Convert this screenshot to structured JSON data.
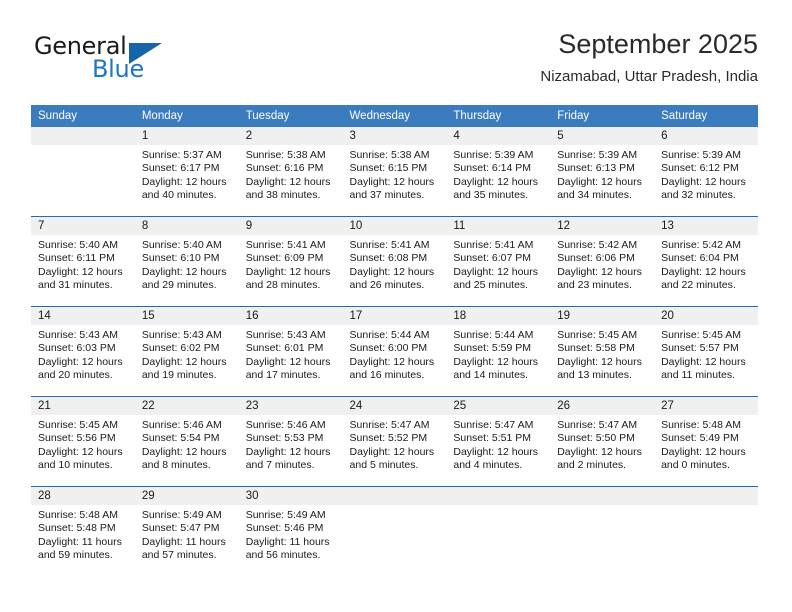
{
  "brand": {
    "name_top": "General",
    "name_bottom": "Blue",
    "color_primary": "#1f77c4",
    "color_triangle": "#1565a8"
  },
  "header": {
    "title": "September 2025",
    "subtitle": "Nizamabad, Uttar Pradesh, India"
  },
  "calendar": {
    "header_bg": "#3a7cbe",
    "daynum_bg": "#f0f0f0",
    "grid_line": "#1f6eb4",
    "weekdays": [
      "Sunday",
      "Monday",
      "Tuesday",
      "Wednesday",
      "Thursday",
      "Friday",
      "Saturday"
    ],
    "weeks": [
      [
        {
          "day": "",
          "sunrise": "",
          "sunset": "",
          "daylight1": "",
          "daylight2": "",
          "empty": true
        },
        {
          "day": "1",
          "sunrise": "Sunrise: 5:37 AM",
          "sunset": "Sunset: 6:17 PM",
          "daylight1": "Daylight: 12 hours",
          "daylight2": "and 40 minutes."
        },
        {
          "day": "2",
          "sunrise": "Sunrise: 5:38 AM",
          "sunset": "Sunset: 6:16 PM",
          "daylight1": "Daylight: 12 hours",
          "daylight2": "and 38 minutes."
        },
        {
          "day": "3",
          "sunrise": "Sunrise: 5:38 AM",
          "sunset": "Sunset: 6:15 PM",
          "daylight1": "Daylight: 12 hours",
          "daylight2": "and 37 minutes."
        },
        {
          "day": "4",
          "sunrise": "Sunrise: 5:39 AM",
          "sunset": "Sunset: 6:14 PM",
          "daylight1": "Daylight: 12 hours",
          "daylight2": "and 35 minutes."
        },
        {
          "day": "5",
          "sunrise": "Sunrise: 5:39 AM",
          "sunset": "Sunset: 6:13 PM",
          "daylight1": "Daylight: 12 hours",
          "daylight2": "and 34 minutes."
        },
        {
          "day": "6",
          "sunrise": "Sunrise: 5:39 AM",
          "sunset": "Sunset: 6:12 PM",
          "daylight1": "Daylight: 12 hours",
          "daylight2": "and 32 minutes."
        }
      ],
      [
        {
          "day": "7",
          "sunrise": "Sunrise: 5:40 AM",
          "sunset": "Sunset: 6:11 PM",
          "daylight1": "Daylight: 12 hours",
          "daylight2": "and 31 minutes."
        },
        {
          "day": "8",
          "sunrise": "Sunrise: 5:40 AM",
          "sunset": "Sunset: 6:10 PM",
          "daylight1": "Daylight: 12 hours",
          "daylight2": "and 29 minutes."
        },
        {
          "day": "9",
          "sunrise": "Sunrise: 5:41 AM",
          "sunset": "Sunset: 6:09 PM",
          "daylight1": "Daylight: 12 hours",
          "daylight2": "and 28 minutes."
        },
        {
          "day": "10",
          "sunrise": "Sunrise: 5:41 AM",
          "sunset": "Sunset: 6:08 PM",
          "daylight1": "Daylight: 12 hours",
          "daylight2": "and 26 minutes."
        },
        {
          "day": "11",
          "sunrise": "Sunrise: 5:41 AM",
          "sunset": "Sunset: 6:07 PM",
          "daylight1": "Daylight: 12 hours",
          "daylight2": "and 25 minutes."
        },
        {
          "day": "12",
          "sunrise": "Sunrise: 5:42 AM",
          "sunset": "Sunset: 6:06 PM",
          "daylight1": "Daylight: 12 hours",
          "daylight2": "and 23 minutes."
        },
        {
          "day": "13",
          "sunrise": "Sunrise: 5:42 AM",
          "sunset": "Sunset: 6:04 PM",
          "daylight1": "Daylight: 12 hours",
          "daylight2": "and 22 minutes."
        }
      ],
      [
        {
          "day": "14",
          "sunrise": "Sunrise: 5:43 AM",
          "sunset": "Sunset: 6:03 PM",
          "daylight1": "Daylight: 12 hours",
          "daylight2": "and 20 minutes."
        },
        {
          "day": "15",
          "sunrise": "Sunrise: 5:43 AM",
          "sunset": "Sunset: 6:02 PM",
          "daylight1": "Daylight: 12 hours",
          "daylight2": "and 19 minutes."
        },
        {
          "day": "16",
          "sunrise": "Sunrise: 5:43 AM",
          "sunset": "Sunset: 6:01 PM",
          "daylight1": "Daylight: 12 hours",
          "daylight2": "and 17 minutes."
        },
        {
          "day": "17",
          "sunrise": "Sunrise: 5:44 AM",
          "sunset": "Sunset: 6:00 PM",
          "daylight1": "Daylight: 12 hours",
          "daylight2": "and 16 minutes."
        },
        {
          "day": "18",
          "sunrise": "Sunrise: 5:44 AM",
          "sunset": "Sunset: 5:59 PM",
          "daylight1": "Daylight: 12 hours",
          "daylight2": "and 14 minutes."
        },
        {
          "day": "19",
          "sunrise": "Sunrise: 5:45 AM",
          "sunset": "Sunset: 5:58 PM",
          "daylight1": "Daylight: 12 hours",
          "daylight2": "and 13 minutes."
        },
        {
          "day": "20",
          "sunrise": "Sunrise: 5:45 AM",
          "sunset": "Sunset: 5:57 PM",
          "daylight1": "Daylight: 12 hours",
          "daylight2": "and 11 minutes."
        }
      ],
      [
        {
          "day": "21",
          "sunrise": "Sunrise: 5:45 AM",
          "sunset": "Sunset: 5:56 PM",
          "daylight1": "Daylight: 12 hours",
          "daylight2": "and 10 minutes."
        },
        {
          "day": "22",
          "sunrise": "Sunrise: 5:46 AM",
          "sunset": "Sunset: 5:54 PM",
          "daylight1": "Daylight: 12 hours",
          "daylight2": "and 8 minutes."
        },
        {
          "day": "23",
          "sunrise": "Sunrise: 5:46 AM",
          "sunset": "Sunset: 5:53 PM",
          "daylight1": "Daylight: 12 hours",
          "daylight2": "and 7 minutes."
        },
        {
          "day": "24",
          "sunrise": "Sunrise: 5:47 AM",
          "sunset": "Sunset: 5:52 PM",
          "daylight1": "Daylight: 12 hours",
          "daylight2": "and 5 minutes."
        },
        {
          "day": "25",
          "sunrise": "Sunrise: 5:47 AM",
          "sunset": "Sunset: 5:51 PM",
          "daylight1": "Daylight: 12 hours",
          "daylight2": "and 4 minutes."
        },
        {
          "day": "26",
          "sunrise": "Sunrise: 5:47 AM",
          "sunset": "Sunset: 5:50 PM",
          "daylight1": "Daylight: 12 hours",
          "daylight2": "and 2 minutes."
        },
        {
          "day": "27",
          "sunrise": "Sunrise: 5:48 AM",
          "sunset": "Sunset: 5:49 PM",
          "daylight1": "Daylight: 12 hours",
          "daylight2": "and 0 minutes."
        }
      ],
      [
        {
          "day": "28",
          "sunrise": "Sunrise: 5:48 AM",
          "sunset": "Sunset: 5:48 PM",
          "daylight1": "Daylight: 11 hours",
          "daylight2": "and 59 minutes."
        },
        {
          "day": "29",
          "sunrise": "Sunrise: 5:49 AM",
          "sunset": "Sunset: 5:47 PM",
          "daylight1": "Daylight: 11 hours",
          "daylight2": "and 57 minutes."
        },
        {
          "day": "30",
          "sunrise": "Sunrise: 5:49 AM",
          "sunset": "Sunset: 5:46 PM",
          "daylight1": "Daylight: 11 hours",
          "daylight2": "and 56 minutes."
        },
        {
          "day": "",
          "sunrise": "",
          "sunset": "",
          "daylight1": "",
          "daylight2": "",
          "empty": true
        },
        {
          "day": "",
          "sunrise": "",
          "sunset": "",
          "daylight1": "",
          "daylight2": "",
          "empty": true
        },
        {
          "day": "",
          "sunrise": "",
          "sunset": "",
          "daylight1": "",
          "daylight2": "",
          "empty": true
        },
        {
          "day": "",
          "sunrise": "",
          "sunset": "",
          "daylight1": "",
          "daylight2": "",
          "empty": true
        }
      ]
    ]
  }
}
